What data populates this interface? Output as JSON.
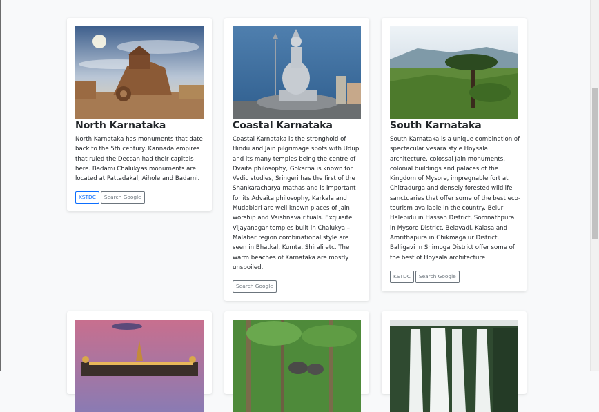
{
  "cards": [
    {
      "title": "North Karnataka",
      "text": "North Karnataka has monuments that date back to the 5th century. Kannada empires that ruled the Deccan had their capitals here. Badami Chalukyas monuments are located at Pattadakal, Aihole and Badami.",
      "kstdc_label": "KSTDC",
      "search_label": "Search Google"
    },
    {
      "title": "Coastal Karnataka",
      "text": "Coastal Karnataka is the stronghold of Hindu and Jain pilgrimage spots with Udupi and its many temples being the centre of Dvaita philosophy, Gokarna is known for Vedic studies, Sringeri has the first of the Shankaracharya mathas and is important for its Advaita philosophy, Karkala and Mudabidri are well known places of Jain worship and Vaishnava rituals. Exquisite Vijayanagar temples built in Chalukya – Malabar region combinational style are seen in Bhatkal, Kumta, Shirali etc. The warm beaches of Karnataka are mostly unspoiled.",
      "search_label": "Search Google"
    },
    {
      "title": "South Karnataka",
      "text": "South Karnataka is a unique combination of spectacular vesara style Hoysala architecture, colossal Jain monuments, colonial buildings and palaces of the Kingdom of Mysore, impregnable fort at Chitradurga and densely forested wildlife sanctuaries that offer some of the best eco-tourism available in the country. Belur, Halebidu in Hassan District, Somnathpura in Mysore District, Belavadi, Kalasa and Amrithapura in Chikmagalur District, Balligavi in Shimoga District offer some of the best of Hoysala architecture",
      "kstdc_label": "KSTDC",
      "search_label": "Search Google"
    }
  ]
}
